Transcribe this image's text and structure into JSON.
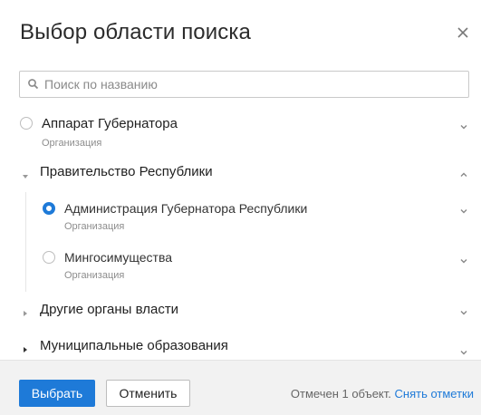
{
  "dialog": {
    "title": "Выбор области поиска",
    "close_icon": "close-icon"
  },
  "search": {
    "placeholder": "Поиск по названию",
    "value": "",
    "icon": "search-icon"
  },
  "tree": {
    "items": [
      {
        "label": "Аппарат Губернатора",
        "meta": "Организация",
        "selected": false,
        "expanded": false
      },
      {
        "label": "Правительство Республики",
        "expanded": true,
        "children": [
          {
            "label": "Администрация Губернатора Республики",
            "meta": "Организация",
            "selected": true
          },
          {
            "label": "Мингосимущества",
            "meta": "Организация",
            "selected": false
          }
        ]
      },
      {
        "label": "Другие органы власти",
        "expanded": false
      },
      {
        "label": "Муниципальные образования",
        "expanded": false
      }
    ]
  },
  "footer": {
    "select_label": "Выбрать",
    "cancel_label": "Отменить",
    "status_text": "Отмечен 1 объект.",
    "clear_label": "Снять отметки"
  },
  "colors": {
    "accent": "#1e7ad8",
    "footer_bg": "#f2f2f2"
  }
}
